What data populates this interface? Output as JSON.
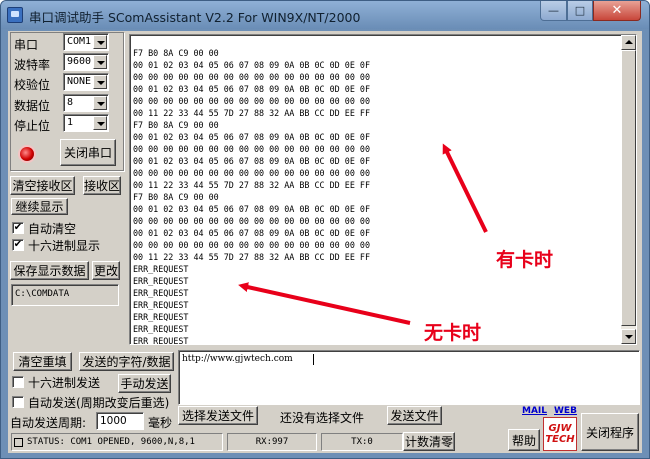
{
  "window": {
    "title": "串口调试助手 SComAssistant V2.2 For WIN9X/NT/2000",
    "minimize_glyph": "—",
    "maximize_glyph": "□",
    "close_glyph": "✕"
  },
  "settings": {
    "port_label": "串口",
    "port_value": "COM1",
    "baud_label": "波特率",
    "baud_value": "9600",
    "parity_label": "校验位",
    "parity_value": "NONE",
    "databits_label": "数据位",
    "databits_value": "8",
    "stopbits_label": "停止位",
    "stopbits_value": "1",
    "close_port_label": "关闭串口"
  },
  "receive": {
    "clear_label": "清空接收区",
    "area_label": "接收区",
    "pause_label": "继续显示",
    "auto_clear_label": "自动清空",
    "auto_clear_checked": "✔",
    "hex_display_label": "十六进制显示",
    "hex_display_checked": "✔",
    "save_label": "保存显示数据",
    "change_label": "更改",
    "save_path": "C:\\COMDATA"
  },
  "output": {
    "lines": [
      "F7 B0 8A C9 00 00",
      "00 01 02 03 04 05 06 07 08 09 0A 0B 0C 0D 0E 0F",
      "00 00 00 00 00 00 00 00 00 00 00 00 00 00 00 00",
      "00 01 02 03 04 05 06 07 08 09 0A 0B 0C 0D 0E 0F",
      "00 00 00 00 00 00 00 00 00 00 00 00 00 00 00 00",
      "00 11 22 33 44 55 7D 27 88 32 AA BB CC DD EE FF",
      "F7 B0 8A C9 00 00",
      "00 01 02 03 04 05 06 07 08 09 0A 0B 0C 0D 0E 0F",
      "00 00 00 00 00 00 00 00 00 00 00 00 00 00 00 00",
      "00 01 02 03 04 05 06 07 08 09 0A 0B 0C 0D 0E 0F",
      "00 00 00 00 00 00 00 00 00 00 00 00 00 00 00 00",
      "00 11 22 33 44 55 7D 27 88 32 AA BB CC DD EE FF",
      "F7 B0 8A C9 00 00",
      "00 01 02 03 04 05 06 07 08 09 0A 0B 0C 0D 0E 0F",
      "00 00 00 00 00 00 00 00 00 00 00 00 00 00 00 00",
      "00 01 02 03 04 05 06 07 08 09 0A 0B 0C 0D 0E 0F",
      "00 00 00 00 00 00 00 00 00 00 00 00 00 00 00 00",
      "00 11 22 33 44 55 7D 27 88 32 AA BB CC DD EE FF",
      "ERR_REQUEST",
      "ERR_REQUEST",
      "ERR_REQUEST",
      "ERR_REQUEST",
      "ERR_REQUEST",
      "ERR_REQUEST",
      "ERR_REQUEST"
    ]
  },
  "annotations": {
    "with_card": "有卡时",
    "without_card": "无卡时",
    "color": "#e8001a"
  },
  "send": {
    "clear_resend_label": "清空重填",
    "sent_chars_label": "发送的字符/数据",
    "hex_send_label": "十六进制发送",
    "manual_send_label": "手动发送",
    "auto_send_label": "自动发送(周期改变后重选)",
    "period_label": "自动发送周期:",
    "period_value": "1000",
    "period_unit": "毫秒",
    "choose_file_label": "选择发送文件",
    "no_file_text": "还没有选择文件",
    "send_file_label": "发送文件",
    "input_value": "http://www.gjwtech.com",
    "mail_link": "MAIL",
    "web_link": "WEB",
    "help_label": "帮助",
    "exit_label": "关闭程序",
    "logo_text_top": "GJW",
    "logo_text_bottom": "TECH"
  },
  "status": {
    "status_text": "STATUS: COM1 OPENED, 9600,N,8,1",
    "rx_text": "RX:997",
    "tx_text": "TX:0",
    "count_clear_label": "计数清零"
  }
}
